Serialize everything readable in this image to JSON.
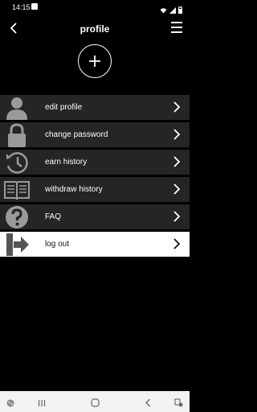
{
  "status_bar": {
    "time": "14:15"
  },
  "header": {
    "title": "profile"
  },
  "menu": {
    "items": [
      {
        "label": "edit profile",
        "icon": "person-icon"
      },
      {
        "label": "change password",
        "icon": "padlock-icon"
      },
      {
        "label": "earn history",
        "icon": "clock-history-icon"
      },
      {
        "label": "withdraw history",
        "icon": "open-book-icon"
      },
      {
        "label": "FAQ",
        "icon": "question-mark-icon"
      },
      {
        "label": "log out",
        "icon": "logout-door-icon"
      }
    ]
  },
  "colors": {
    "background": "#000000",
    "row_background": "#252525",
    "logout_row_background": "#ffffff",
    "nav_bar": "#f2f2f2"
  }
}
